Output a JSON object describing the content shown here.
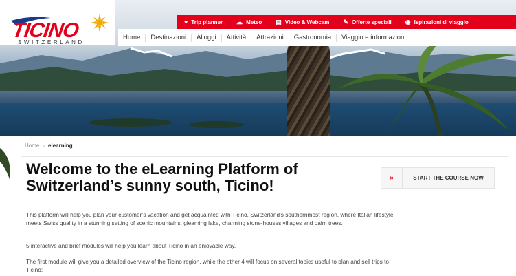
{
  "brand": {
    "logo_text": "TICINO",
    "logo_sub": "SWITZERLAND"
  },
  "topbar": {
    "items": [
      {
        "label": "Trip planner",
        "icon": "heart-icon",
        "glyph": "♥"
      },
      {
        "label": "Meteo",
        "icon": "cloud-icon",
        "glyph": "☁"
      },
      {
        "label": "Video & Webcam",
        "icon": "video-icon",
        "glyph": "▤"
      },
      {
        "label": "Offerte speciali",
        "icon": "tag-icon",
        "glyph": "✎"
      },
      {
        "label": "Ispirazioni di viaggio",
        "icon": "eye-icon",
        "glyph": "◉"
      }
    ]
  },
  "nav": {
    "items": [
      "Home",
      "Destinazioni",
      "Alloggi",
      "Attività",
      "Attrazioni",
      "Gastronomia",
      "Viaggio e informazioni"
    ]
  },
  "breadcrumb": {
    "home": "Home",
    "separator": "›",
    "current": "elearning"
  },
  "main": {
    "title": "Welcome to the eLearning Platform of Switzerland’s sunny south, Ticino!",
    "paragraphs": [
      "This platform will help you plan your customer’s vacation and get acquainted with Ticino, Switzerland’s southernmost region, where Italian lifestyle meets Swiss quality in a stunning setting of scenic mountains, gleaming lake, charming stone-houses villages and palm trees.",
      "5 interactive and brief modules will help you learn about Ticino in an enjoyable way.",
      "The first module will give you a detailed overview of the Ticino region, while the other 4 will focus on several topics useful to plan and sell trips to Ticino:"
    ]
  },
  "cta": {
    "arrows": "»",
    "label": "START THE COURSE NOW"
  },
  "colors": {
    "brand_red": "#e3001b"
  }
}
